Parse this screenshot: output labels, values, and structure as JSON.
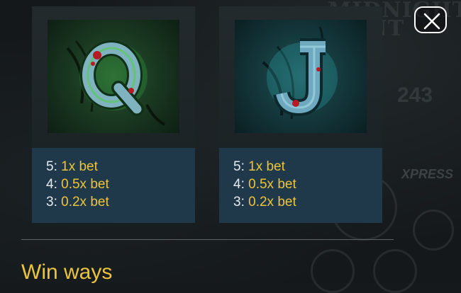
{
  "background": {
    "game_logo": [
      "MIDNIGHT",
      "HUNT"
    ],
    "counter": "243",
    "xpress_label": "XPRESS"
  },
  "close_button": {
    "icon": "close-icon"
  },
  "paytable": {
    "symbols": [
      {
        "letter": "Q",
        "payouts": [
          {
            "count": "5:",
            "value": "1x bet"
          },
          {
            "count": "4:",
            "value": "0.5x bet"
          },
          {
            "count": "3:",
            "value": "0.2x bet"
          }
        ]
      },
      {
        "letter": "J",
        "payouts": [
          {
            "count": "5:",
            "value": "1x bet"
          },
          {
            "count": "4:",
            "value": "0.5x bet"
          },
          {
            "count": "3:",
            "value": "0.2x bet"
          }
        ]
      }
    ]
  },
  "section_title": "Win ways",
  "colors": {
    "accent": "#ecc43c",
    "text": "#e3ebf0",
    "panel": "#20394a",
    "q_glow": "#3fbf4a",
    "j_glow": "#3fc7c9"
  }
}
